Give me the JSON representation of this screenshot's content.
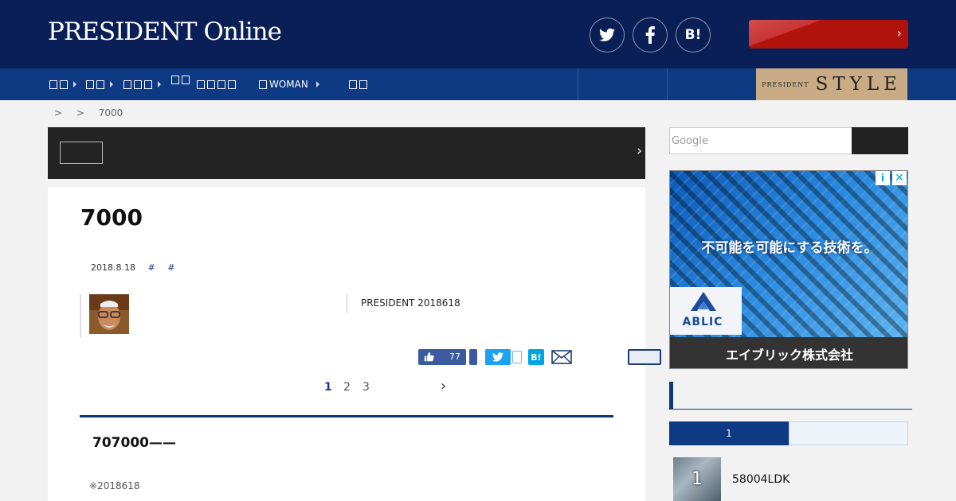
{
  "header": {
    "logo": "PRESIDENT Online",
    "social": [
      {
        "icon": "twitter-icon",
        "label": ""
      },
      {
        "icon": "facebook-icon",
        "label": ""
      },
      {
        "icon": "hatena-bookmark-icon",
        "label": "B!"
      }
    ],
    "cta_label": "",
    "cta_chevron": "›"
  },
  "nav": {
    "items": [
      {
        "label": "",
        "has_arrow": true
      },
      {
        "label": "",
        "has_arrow": true
      },
      {
        "label": "",
        "has_arrow": true
      },
      {
        "label": "",
        "has_arrow": false
      },
      {
        "label": "",
        "has_arrow": false
      },
      {
        "label": "WOMAN",
        "has_arrow": true
      },
      {
        "label": "",
        "has_arrow": false
      }
    ],
    "style_banner": {
      "small": "PRESIDENT",
      "big": "STYLE",
      "color": "#c9ac85"
    }
  },
  "breadcrumb": [
    ">",
    ">",
    "7000"
  ],
  "darkbar": {
    "button_label": "",
    "chevron": "›"
  },
  "article": {
    "title": "7000",
    "date": "2018.8.18",
    "tags": [
      "#",
      "#"
    ],
    "source": "PRESIDENT 2018618",
    "share": {
      "like_count": "77",
      "hatena_label": "B!"
    },
    "pager": {
      "pages": [
        "1",
        "2",
        "3"
      ],
      "current": "1",
      "next": "›"
    },
    "lead": "707000——",
    "note": "※2018618"
  },
  "sidebar": {
    "search_placeholder": "Google",
    "search_button_label": "",
    "ad": {
      "headline": "不可能を可能にする技術を。",
      "brand": "ABLIC",
      "footer": "エイブリック株式会社",
      "info": "i",
      "close": "✕"
    },
    "section_title": "",
    "tabs": [
      "1",
      ""
    ],
    "ranking": [
      {
        "rank": "1",
        "title": "58004LDK"
      }
    ]
  },
  "colors": {
    "header_bg": "#0a1f56",
    "nav_bg": "#0d3a82",
    "cta_red": "#b0120c",
    "accent_blue": "#1a3f8c"
  }
}
